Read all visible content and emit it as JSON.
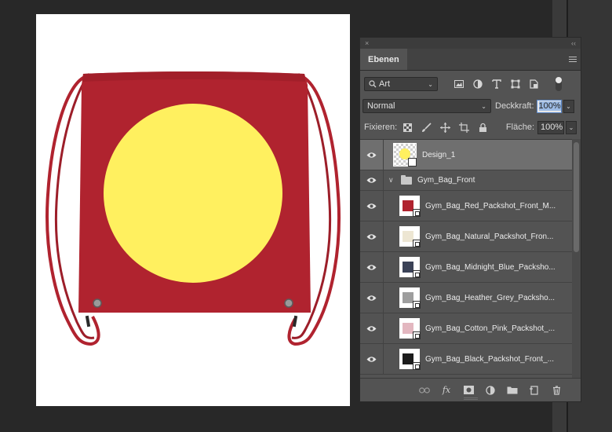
{
  "panel": {
    "close_glyph": "×",
    "collapse_glyph": "‹‹",
    "tab_label": "Ebenen",
    "filter_select": "Art",
    "blend_mode": "Normal",
    "opacity_label": "Deckkraft:",
    "opacity_value": "100%",
    "lock_label": "Fixieren:",
    "fill_label": "Fläche:",
    "fill_value": "100%"
  },
  "layers": [
    {
      "name": "Design_1",
      "kind": "smart-object",
      "selected": true
    },
    {
      "name": "Gym_Bag_Front",
      "kind": "group"
    },
    {
      "name": "Gym_Bag_Red_Packshot_Front_M...",
      "swatch": "#b0232f"
    },
    {
      "name": "Gym_Bag_Natural_Packshot_Fron...",
      "swatch": "#ede6d3"
    },
    {
      "name": "Gym_Bag_Midnight_Blue_Packsho...",
      "swatch": "#3b4257"
    },
    {
      "name": "Gym_Bag_Heather_Grey_Packsho...",
      "swatch": "#9e9e9e"
    },
    {
      "name": "Gym_Bag_Cotton_Pink_Packshot_...",
      "swatch": "#e3b7c0"
    },
    {
      "name": "Gym_Bag_Black_Packshot_Front_...",
      "swatch": "#1c1c1c"
    }
  ],
  "icons": {
    "filter": [
      "image-filter-icon",
      "adjustment-filter-icon",
      "text-filter-icon",
      "shape-filter-icon",
      "smart-object-filter-icon"
    ],
    "lock": [
      "lock-transparent-pixels-icon",
      "lock-image-pixels-icon",
      "lock-position-icon",
      "lock-artboard-icon",
      "lock-all-icon"
    ],
    "footer": [
      "link-layers-icon",
      "fx-icon",
      "add-mask-icon",
      "adjustment-layer-icon",
      "new-group-icon",
      "new-layer-icon",
      "trash-icon"
    ]
  },
  "colors": {
    "bag_red": "#b0232f",
    "design_yellow": "#fff05f",
    "panel_bg": "#535353",
    "selection": "#6f6f6f"
  }
}
